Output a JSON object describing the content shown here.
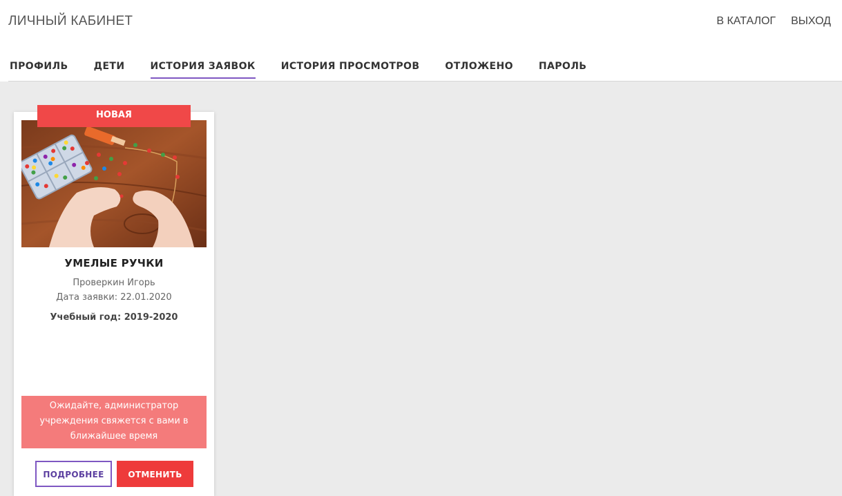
{
  "header": {
    "title": "ЛИЧНЫЙ КАБИНЕТ",
    "links": [
      "В КАТАЛОГ",
      "ВЫХОД"
    ]
  },
  "tabs": [
    {
      "label": "ПРОФИЛЬ",
      "active": false
    },
    {
      "label": "ДЕТИ",
      "active": false
    },
    {
      "label": "ИСТОРИЯ ЗАЯВОК",
      "active": true
    },
    {
      "label": "ИСТОРИЯ ПРОСМОТРОВ",
      "active": false
    },
    {
      "label": "ОТЛОЖЕНО",
      "active": false
    },
    {
      "label": "ПАРОЛЬ",
      "active": false
    }
  ],
  "card": {
    "badge": "НОВАЯ",
    "title": "УМЕЛЫЕ РУЧКИ",
    "child": "Проверкин Игорь",
    "date": "Дата заявки: 22.01.2020",
    "year": "Учебный год: 2019-2020",
    "notice": "Ожидайте, администратор учреждения свяжется с вами в ближайшее время",
    "more_label": "ПОДРОБНЕЕ",
    "cancel_label": "ОТМЕНИТЬ"
  },
  "colors": {
    "accent": "#7e57c2",
    "badge": "#f04848",
    "notice": "#f47b7b",
    "cancel": "#ee3b3b",
    "background": "#ebebeb"
  }
}
